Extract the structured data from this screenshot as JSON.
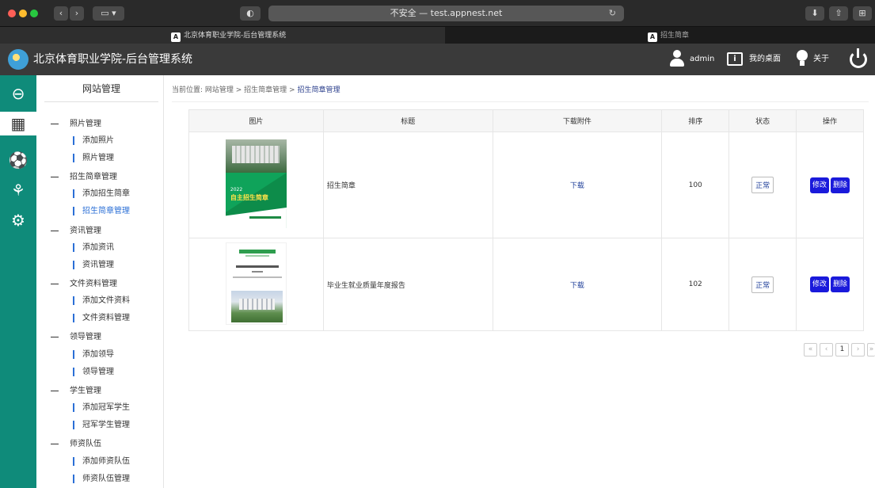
{
  "browser": {
    "address": "不安全 — test.appnest.net",
    "tabs": [
      {
        "label": "北京体育职业学院-后台管理系统",
        "favicon": "A"
      },
      {
        "label": "招生简章",
        "favicon": "A"
      }
    ]
  },
  "header": {
    "title": "北京体育职业学院-后台管理系统",
    "user": "admin",
    "desk_icon_text": "i",
    "desktop": "我的桌面",
    "about": "关于"
  },
  "rail": {
    "icons": [
      "back-arrow-icon",
      "grid-icon",
      "ball-icon",
      "runner-icon",
      "gear-icon"
    ]
  },
  "sidebar": {
    "title": "网站管理",
    "groups": [
      {
        "label": "照片管理",
        "items": [
          "添加照片",
          "照片管理"
        ]
      },
      {
        "label": "招生简章管理",
        "items": [
          "添加招生简章",
          "招生简章管理"
        ]
      },
      {
        "label": "资讯管理",
        "items": [
          "添加资讯",
          "资讯管理"
        ]
      },
      {
        "label": "文件资料管理",
        "items": [
          "添加文件资料",
          "文件资料管理"
        ]
      },
      {
        "label": "领导管理",
        "items": [
          "添加领导",
          "领导管理"
        ]
      },
      {
        "label": "学生管理",
        "items": [
          "添加冠军学生",
          "冠军学生管理"
        ]
      },
      {
        "label": "师资队伍",
        "items": [
          "添加师资队伍",
          "师资队伍管理"
        ]
      }
    ],
    "active_item": "招生简章管理"
  },
  "breadcrumb": {
    "prefix": "当前位置:",
    "path": "网站管理 > 招生简章管理 >",
    "current": "招生简章管理"
  },
  "table": {
    "headers": [
      "图片",
      "标题",
      "下载附件",
      "排序",
      "状态",
      "操作"
    ],
    "rows": [
      {
        "title": "招生简章",
        "download": "下载",
        "order": "100",
        "status": "正常",
        "edit": "修改",
        "delete": "删除",
        "thumb_year": "2022",
        "thumb_title": "自主招生简章"
      },
      {
        "title": "毕业生就业质量年度报告",
        "download": "下载",
        "order": "102",
        "status": "正常",
        "edit": "修改",
        "delete": "删除"
      }
    ]
  },
  "pager": {
    "first": "«",
    "prev": "‹",
    "page": "1",
    "next": "›",
    "last": "»"
  },
  "colors": {
    "rail": "#0f8b7a",
    "header": "#3a3a3a",
    "action_button": "#1a1adb",
    "link": "#1f3f9a",
    "active_nav": "#2b6fd6"
  }
}
